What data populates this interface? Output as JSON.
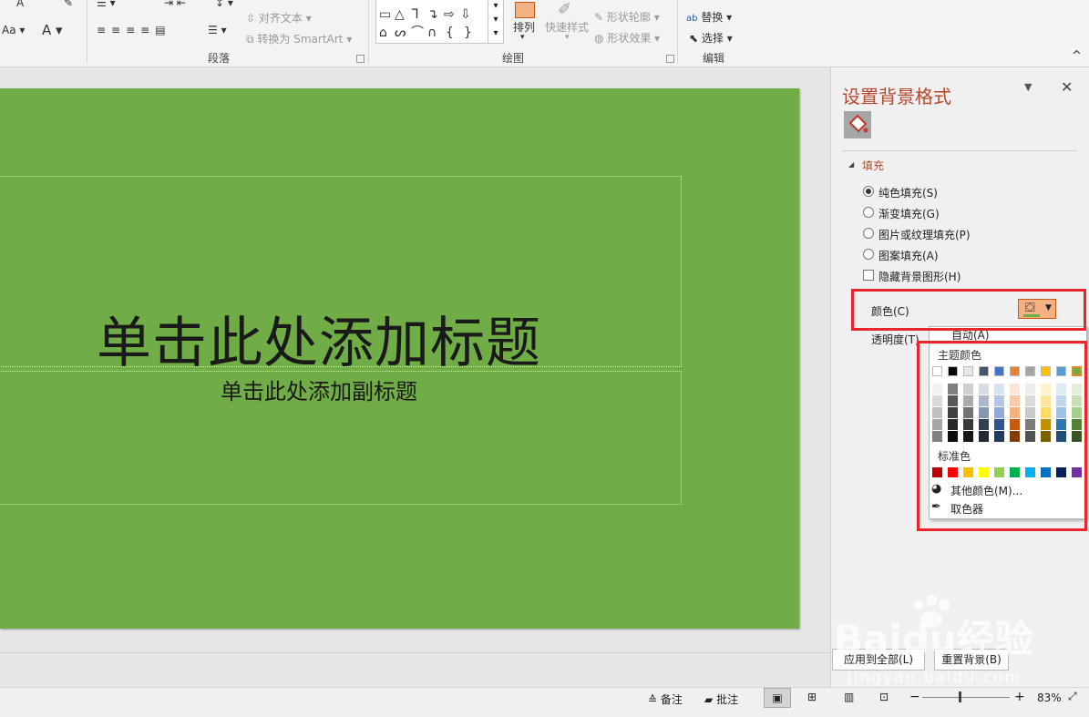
{
  "ribbon": {
    "para_group_label": "段落",
    "draw_group_label": "绘图",
    "edit_group_label": "编辑",
    "align_text": "对齐文本",
    "convert_smartart": "转换为 SmartArt",
    "arrange": "排列",
    "quick_styles": "快速样式",
    "shape_outline": "形状轮廓",
    "shape_effects": "形状效果",
    "replace": "替换",
    "select": "选择"
  },
  "slide": {
    "title": "单击此处添加标题",
    "subtitle": "单击此处添加副标题",
    "background_color": "#70ad47"
  },
  "panel": {
    "title": "设置背景格式",
    "section_fill": "填充",
    "options": [
      {
        "label": "纯色填充(S)",
        "selected": true
      },
      {
        "label": "渐变填充(G)",
        "selected": false
      },
      {
        "label": "图片或纹理填充(P)",
        "selected": false
      },
      {
        "label": "图案填充(A)",
        "selected": false
      }
    ],
    "hide_bg_graphics": "隐藏背景图形(H)",
    "color_label": "颜色(C)",
    "transparency_label": "透明度(T)",
    "apply_all": "应用到全部(L)",
    "reset_bg": "重置背景(B)"
  },
  "color_menu": {
    "auto": "自动(A)",
    "theme_colors_label": "主题颜色",
    "standard_colors_label": "标准色",
    "more_colors": "其他颜色(M)...",
    "eyedropper": "取色器",
    "theme_top": [
      "#ffffff",
      "#000000",
      "#e7e6e6",
      "#44546a",
      "#4472c4",
      "#ed7d31",
      "#a5a5a5",
      "#ffc000",
      "#5b9bd5",
      "#70ad47"
    ],
    "theme_shades": [
      [
        "#f2f2f2",
        "#d9d9d9",
        "#bfbfbf",
        "#a6a6a6",
        "#808080"
      ],
      [
        "#7f7f7f",
        "#595959",
        "#404040",
        "#262626",
        "#0d0d0d"
      ],
      [
        "#d0cece",
        "#aeaaaa",
        "#757171",
        "#3a3838",
        "#171616"
      ],
      [
        "#d6dce4",
        "#adb9ca",
        "#8497b0",
        "#333f4f",
        "#222a35"
      ],
      [
        "#d9e2f3",
        "#b4c6e7",
        "#8eaadb",
        "#2f5496",
        "#1f3864"
      ],
      [
        "#fbe5d5",
        "#f7caac",
        "#f4b083",
        "#c55a11",
        "#833c0b"
      ],
      [
        "#ededed",
        "#dbdbdb",
        "#c9c9c9",
        "#7b7b7b",
        "#525252"
      ],
      [
        "#fff2cc",
        "#fee599",
        "#ffd965",
        "#bf9000",
        "#7f6000"
      ],
      [
        "#deebf6",
        "#bdd7ee",
        "#9cc3e5",
        "#2e75b5",
        "#1e4e79"
      ],
      [
        "#e2efd9",
        "#c5e0b3",
        "#a8d08d",
        "#538135",
        "#375623"
      ]
    ],
    "standard": [
      "#c00000",
      "#ff0000",
      "#ffc000",
      "#ffff00",
      "#92d050",
      "#00b050",
      "#00b0f0",
      "#0070c0",
      "#002060",
      "#7030a0"
    ]
  },
  "status": {
    "notes": "备注",
    "comments": "批注",
    "zoom": "83%"
  },
  "watermark": {
    "brand": "Baidu经验",
    "url": "jingyan.baidu.com"
  }
}
